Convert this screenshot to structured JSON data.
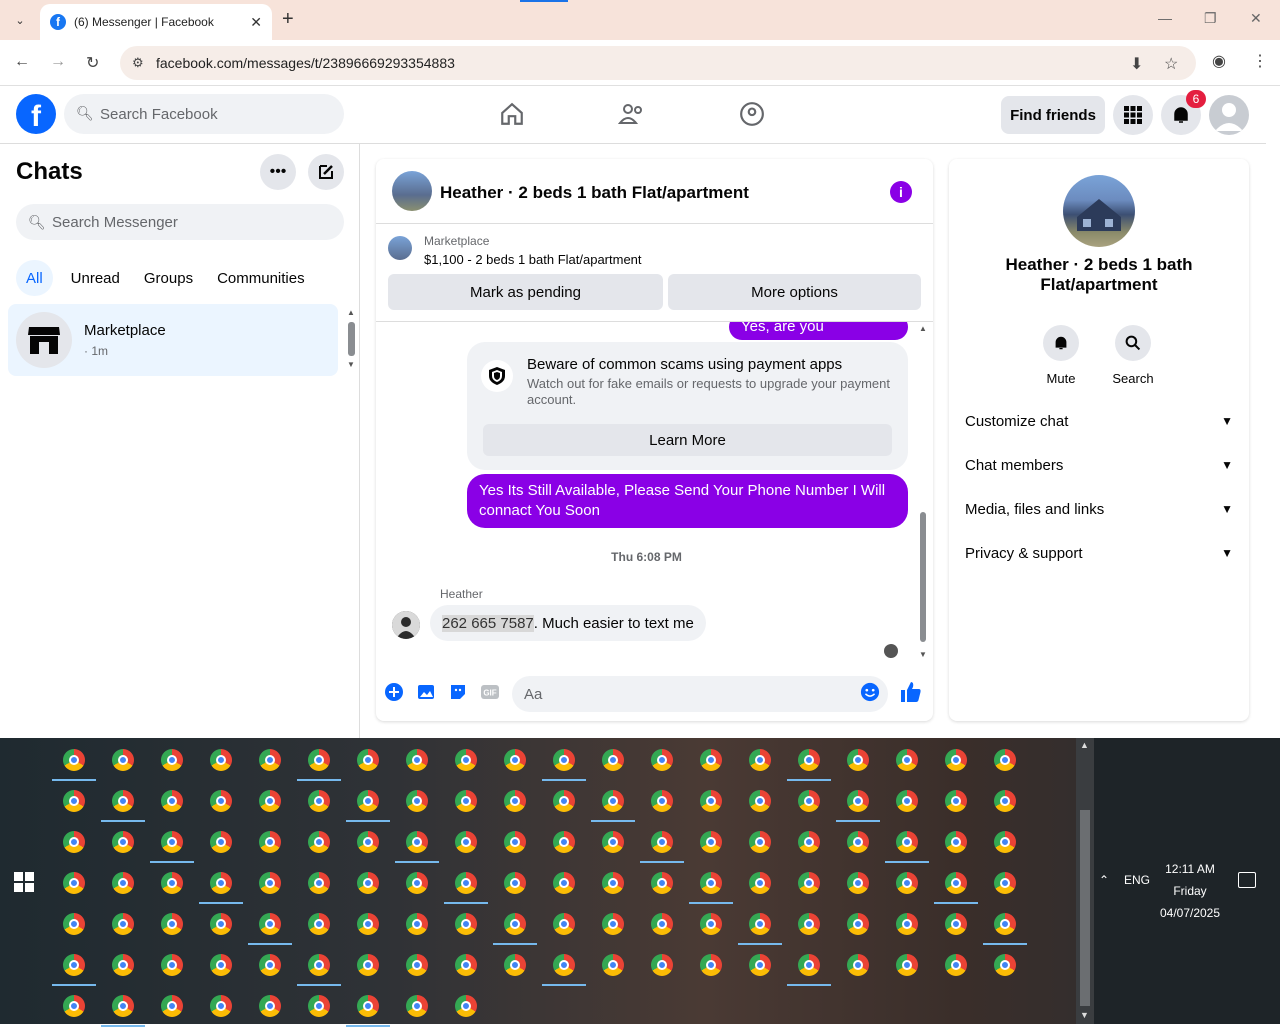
{
  "browser": {
    "tab_title": "(6) Messenger | Facebook",
    "url": "facebook.com/messages/t/23896669293354883"
  },
  "fb": {
    "search_placeholder": "Search Facebook",
    "find_friends": "Find friends",
    "notif_count": "6"
  },
  "chats": {
    "title": "Chats",
    "search_placeholder": "Search Messenger",
    "filters": [
      "All",
      "Unread",
      "Groups",
      "Communities"
    ],
    "items": [
      {
        "name": "Marketplace",
        "sub": "· 1m"
      }
    ]
  },
  "conversation": {
    "title": "Heather · 2 beds 1 bath Flat/apartment",
    "marketplace_label": "Marketplace",
    "listing": "$1,100 - 2 beds 1 bath Flat/apartment",
    "mark_pending": "Mark as pending",
    "more_options": "More options",
    "msg_out_1": "Yes, are you interested?",
    "warning_title": "Beware of common scams using payment apps",
    "warning_body": "Watch out for fake emails or requests to upgrade your payment account.",
    "learn_more": "Learn More",
    "msg_out_2": "Yes Its Still Available, Please Send Your Phone Number I Will connact You Soon",
    "timestamp": "Thu 6:08 PM",
    "sender": "Heather",
    "msg_in_phone": "262 665 7587",
    "msg_in_rest": ". Much easier to text me",
    "composer_placeholder": "Aa"
  },
  "details": {
    "title": "Heather · 2 beds 1 bath Flat/apartment",
    "mute": "Mute",
    "search": "Search",
    "sections": [
      "Customize chat",
      "Chat members",
      "Media, files and links",
      "Privacy & support"
    ]
  },
  "taskbar": {
    "lang": "ENG",
    "time": "12:11 AM",
    "day": "Friday",
    "date": "04/07/2025"
  },
  "colors": {
    "messenger_purple": "#8a00e6",
    "fb_blue": "#0866ff"
  }
}
